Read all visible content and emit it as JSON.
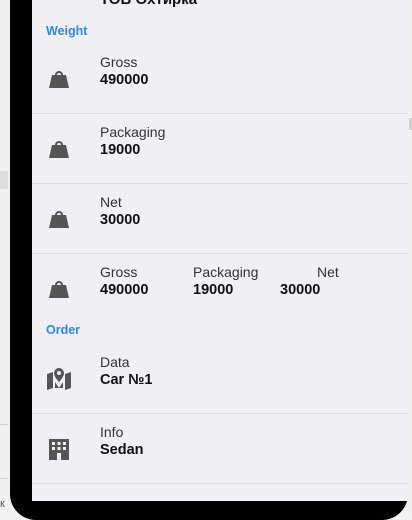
{
  "top_partial": "ТОВ Охтирка",
  "sections": {
    "weight": "Weight",
    "order": "Order"
  },
  "rows": [
    {
      "label": "Gross",
      "value": "490000",
      "icon": "weight-icon"
    },
    {
      "label": "Packaging",
      "value": "19000",
      "icon": "weight-icon"
    },
    {
      "label": "Net",
      "value": "30000",
      "icon": "weight-icon"
    }
  ],
  "multi": {
    "icon": "weight-icon",
    "cols": [
      {
        "label": "Gross",
        "value": "490000"
      },
      {
        "label": "Packaging",
        "value": "19000"
      },
      {
        "label": "Net",
        "value": "30000"
      }
    ]
  },
  "order_rows": [
    {
      "label": "Data",
      "value": "Car №1",
      "icon": "map-marker-icon"
    },
    {
      "label": "Info",
      "value": "Sedan",
      "icon": "building-icon"
    }
  ],
  "underlay_text": "к"
}
